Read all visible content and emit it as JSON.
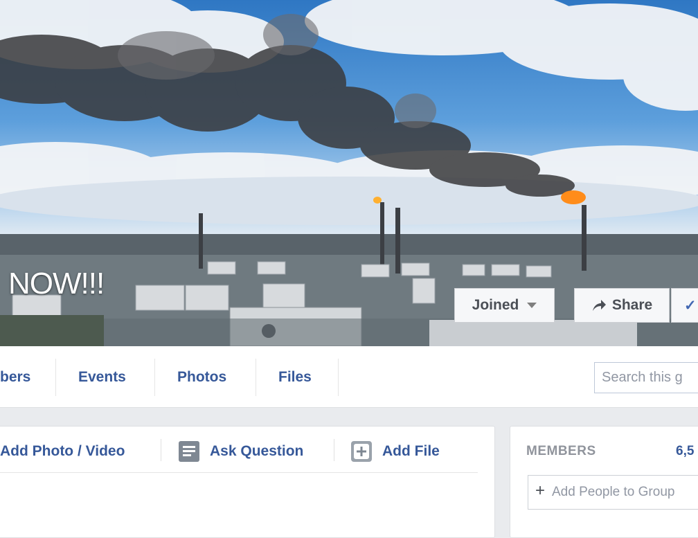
{
  "cover": {
    "title": "NOW!!!",
    "buttons": {
      "joined_label": "Joined",
      "share_label": "Share",
      "notifications_label": "✓"
    }
  },
  "tabs": [
    {
      "label": "bers"
    },
    {
      "label": "Events"
    },
    {
      "label": "Photos"
    },
    {
      "label": "Files"
    }
  ],
  "search": {
    "placeholder": "Search this g"
  },
  "composer": {
    "actions": [
      {
        "label": "Add Photo / Video",
        "icon": "photo-icon"
      },
      {
        "label": "Ask Question",
        "icon": "question-icon"
      },
      {
        "label": "Add File",
        "icon": "file-icon"
      }
    ]
  },
  "members": {
    "heading": "MEMBERS",
    "count": "6,5",
    "add_placeholder": "Add People to Group"
  },
  "colors": {
    "link": "#365899",
    "page_bg": "#e9ebee",
    "flame": "#ff8c1a"
  }
}
